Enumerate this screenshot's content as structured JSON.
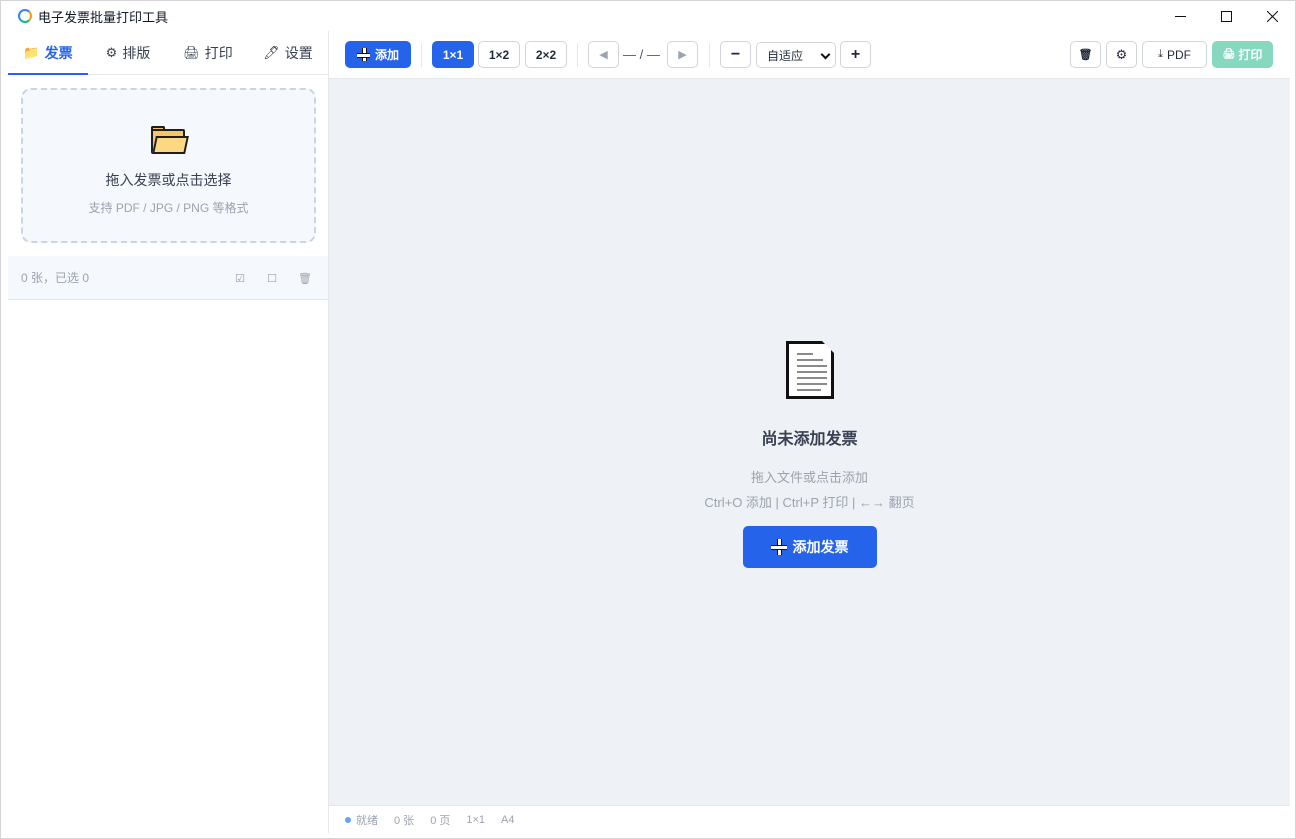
{
  "window": {
    "title": "电子发票批量打印工具",
    "controls": [
      "minimize",
      "maximize",
      "close"
    ]
  },
  "sidebar": {
    "tabs": [
      {
        "icon": "📁",
        "icon_name": "folder-icon",
        "label": "发票",
        "active": true
      },
      {
        "icon": "⚙",
        "icon_name": "gear-icon",
        "label": "排版",
        "active": false
      },
      {
        "icon": "🖨",
        "icon_name": "printer-icon",
        "label": "打印",
        "active": false
      },
      {
        "icon": "🖊",
        "icon_name": "pen-icon",
        "label": "设置",
        "active": false
      }
    ],
    "dropzone": {
      "title": "拖入发票或点击选择",
      "subtitle": "支持 PDF / JPG / PNG 等格式"
    },
    "list_bar": {
      "count_text": "0 张，已选 0",
      "actions": [
        {
          "icon": "☑",
          "name": "select-all-icon"
        },
        {
          "icon": "☐",
          "name": "deselect-icon"
        },
        {
          "icon": "🗑",
          "name": "delete-icon"
        }
      ]
    }
  },
  "toolbar": {
    "add_label": "添加",
    "layouts": [
      {
        "label": "1×1",
        "active": true
      },
      {
        "label": "1×2",
        "active": false
      },
      {
        "label": "2×2",
        "active": false
      }
    ],
    "prev_icon": "◀",
    "page_indicator": "— / —",
    "next_icon": "▶",
    "zoom_out": "−",
    "zoom_select": "自适应",
    "zoom_in": "+",
    "trash_icon": "🗑",
    "settings_icon": "⚙",
    "pdf_label": "PDF",
    "print_label": "打印"
  },
  "empty_state": {
    "title": "尚未添加发票",
    "hint": "拖入文件或点击添加",
    "shortcuts": "Ctrl+O 添加 | Ctrl+P 打印 | ←→ 翻页",
    "button_label": "添加发票"
  },
  "statusbar": {
    "status": "就绪",
    "count": "0 张",
    "pages": "0 页",
    "layout": "1×1",
    "paper": "A4"
  },
  "colors": {
    "accent": "#2563eb",
    "print_disabled": "#86d8bf",
    "canvas_bg": "#eef1f5"
  }
}
